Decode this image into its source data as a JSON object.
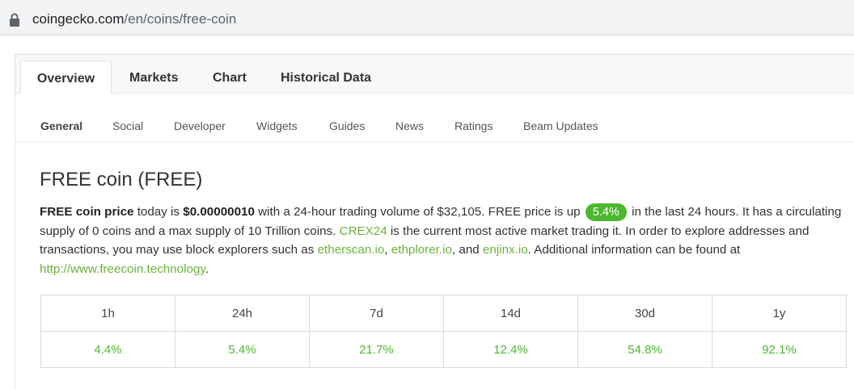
{
  "browser": {
    "url_domain": "coingecko.com",
    "url_path": "/en/coins/free-coin"
  },
  "tabs": [
    {
      "label": "Overview",
      "active": true
    },
    {
      "label": "Markets",
      "active": false
    },
    {
      "label": "Chart",
      "active": false
    },
    {
      "label": "Historical Data",
      "active": false
    }
  ],
  "subnav": [
    {
      "label": "General",
      "active": true
    },
    {
      "label": "Social"
    },
    {
      "label": "Developer"
    },
    {
      "label": "Widgets"
    },
    {
      "label": "Guides"
    },
    {
      "label": "News"
    },
    {
      "label": "Ratings"
    },
    {
      "label": "Beam Updates"
    }
  ],
  "coin": {
    "title": "FREE coin (FREE)",
    "desc": {
      "name_bold": "FREE coin price",
      "t1": " today is ",
      "price_bold": "$0.00000010",
      "t2": " with a 24-hour trading volume of $32,105. FREE price is up ",
      "change_pill": "5.4%",
      "t3": " in the last 24 hours. It has a circulating supply of 0 coins and a max supply of 10 Trillion coins. ",
      "exchange_link": "CREX24",
      "t4": " is the current most active market trading it. In order to explore addresses and transactions, you may use block explorers such as ",
      "explorer1": "etherscan.io",
      "sep1": ", ",
      "explorer2": "ethplorer.io",
      "sep2": ", and ",
      "explorer3": "enjinx.io",
      "t5": ". Additional information can be found at ",
      "website_link": "http://www.freecoin.technology",
      "t6": "."
    }
  },
  "performance": {
    "headers": [
      "1h",
      "24h",
      "7d",
      "14d",
      "30d",
      "1y"
    ],
    "values": [
      "4.4%",
      "5.4%",
      "21.7%",
      "12.4%",
      "54.8%",
      "92.1%"
    ]
  },
  "colors": {
    "positive": "#4db82e",
    "link": "#6cb33f"
  }
}
